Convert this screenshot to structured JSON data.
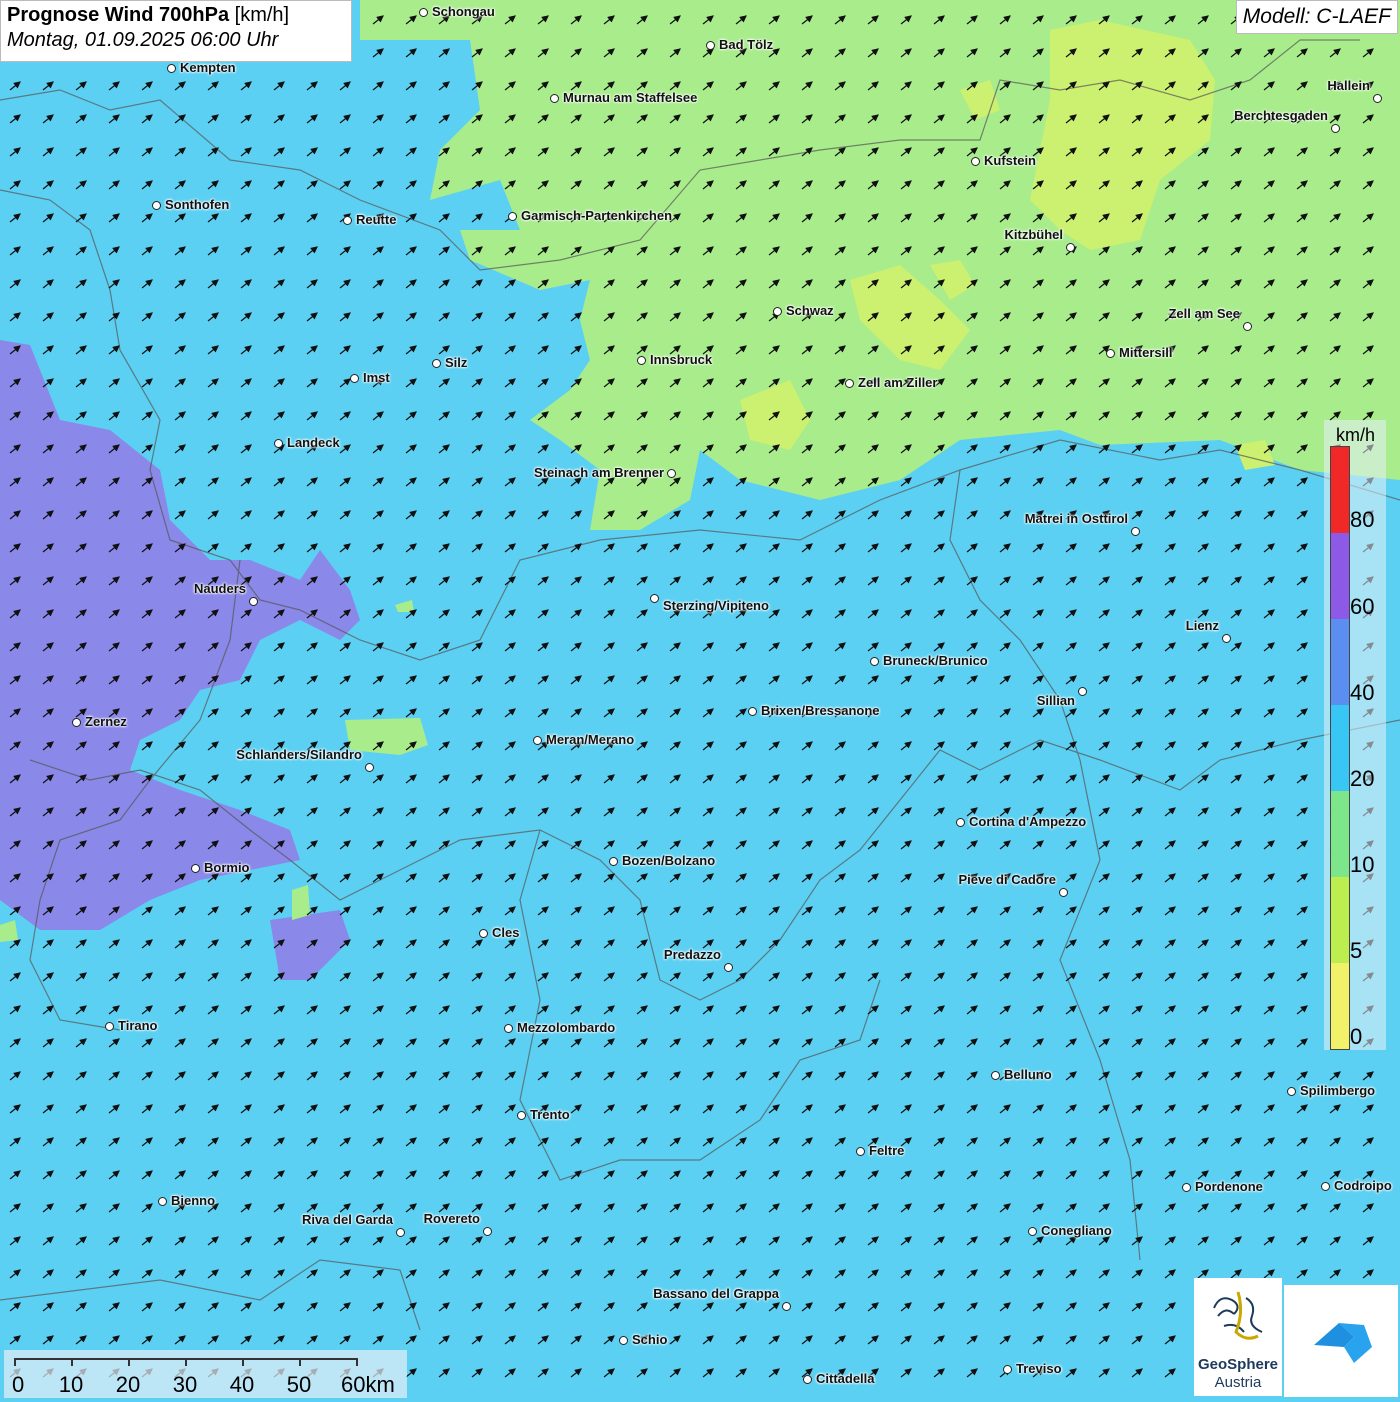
{
  "title": {
    "bold": "Prognose Wind 700hPa",
    "unit": "[km/h]",
    "datetime": "Montag, 01.09.2025 06:00 Uhr"
  },
  "model": "Modell: C-LAEF",
  "legend": {
    "unit": "km/h",
    "labels": [
      "80",
      "60",
      "40",
      "20",
      "10",
      "5",
      "0"
    ],
    "colors": [
      "#f02828",
      "#8c5ae6",
      "#5a8ef0",
      "#38c6f4",
      "#7ee68a",
      "#bcee50",
      "#f2f26a"
    ]
  },
  "scale_bar": {
    "labels": [
      "0",
      "10",
      "20",
      "30",
      "40",
      "50",
      "60km"
    ]
  },
  "cities": [
    {
      "name": "Schongau"
    },
    {
      "name": "Kempten"
    },
    {
      "name": "Bad Tölz"
    },
    {
      "name": "Murnau am Staffelsee"
    },
    {
      "name": "Hallein"
    },
    {
      "name": "Berchtesgaden"
    },
    {
      "name": "Kufstein"
    },
    {
      "name": "Sonthofen"
    },
    {
      "name": "Reutte"
    },
    {
      "name": "Garmisch-Partenkirchen"
    },
    {
      "name": "Kitzbühel"
    },
    {
      "name": "Schwaz"
    },
    {
      "name": "Zell am See"
    },
    {
      "name": "Mittersill"
    },
    {
      "name": "Innsbruck"
    },
    {
      "name": "Silz"
    },
    {
      "name": "Imst"
    },
    {
      "name": "Zell am Ziller"
    },
    {
      "name": "Landeck"
    },
    {
      "name": "Steinach am Brenner"
    },
    {
      "name": "Matrei in Osttirol"
    },
    {
      "name": "Nauders"
    },
    {
      "name": "Sterzing/Vipiteno"
    },
    {
      "name": "Lienz"
    },
    {
      "name": "Bruneck/Brunico"
    },
    {
      "name": "Sillian"
    },
    {
      "name": "Brixen/Bressanone"
    },
    {
      "name": "Zernez"
    },
    {
      "name": "Meran/Merano"
    },
    {
      "name": "Schlanders/Silandro"
    },
    {
      "name": "Cortina d'Ampezzo"
    },
    {
      "name": "Bozen/Bolzano"
    },
    {
      "name": "Bormio"
    },
    {
      "name": "Pieve di Cadore"
    },
    {
      "name": "Cles"
    },
    {
      "name": "Predazzo"
    },
    {
      "name": "Tirano"
    },
    {
      "name": "Mezzolombardo"
    },
    {
      "name": "Belluno"
    },
    {
      "name": "Spilimbergo"
    },
    {
      "name": "Trento"
    },
    {
      "name": "Feltre"
    },
    {
      "name": "Pordenone"
    },
    {
      "name": "Codroipo"
    },
    {
      "name": "Bienno"
    },
    {
      "name": "Riva del Garda"
    },
    {
      "name": "Rovereto"
    },
    {
      "name": "Conegliano"
    },
    {
      "name": "Bassano del Grappa"
    },
    {
      "name": "Schio"
    },
    {
      "name": "Treviso"
    },
    {
      "name": "Cittadella"
    }
  ],
  "logos": {
    "geosphere_line1": "GeoSphere",
    "geosphere_line2": "Austria"
  },
  "colors": {
    "sea_level_wind_blue": "#5cd0f2",
    "green_zone": "#a8ec8c",
    "yellowgreen_zone": "#ccf070",
    "purple_zone": "#8a88e8"
  }
}
